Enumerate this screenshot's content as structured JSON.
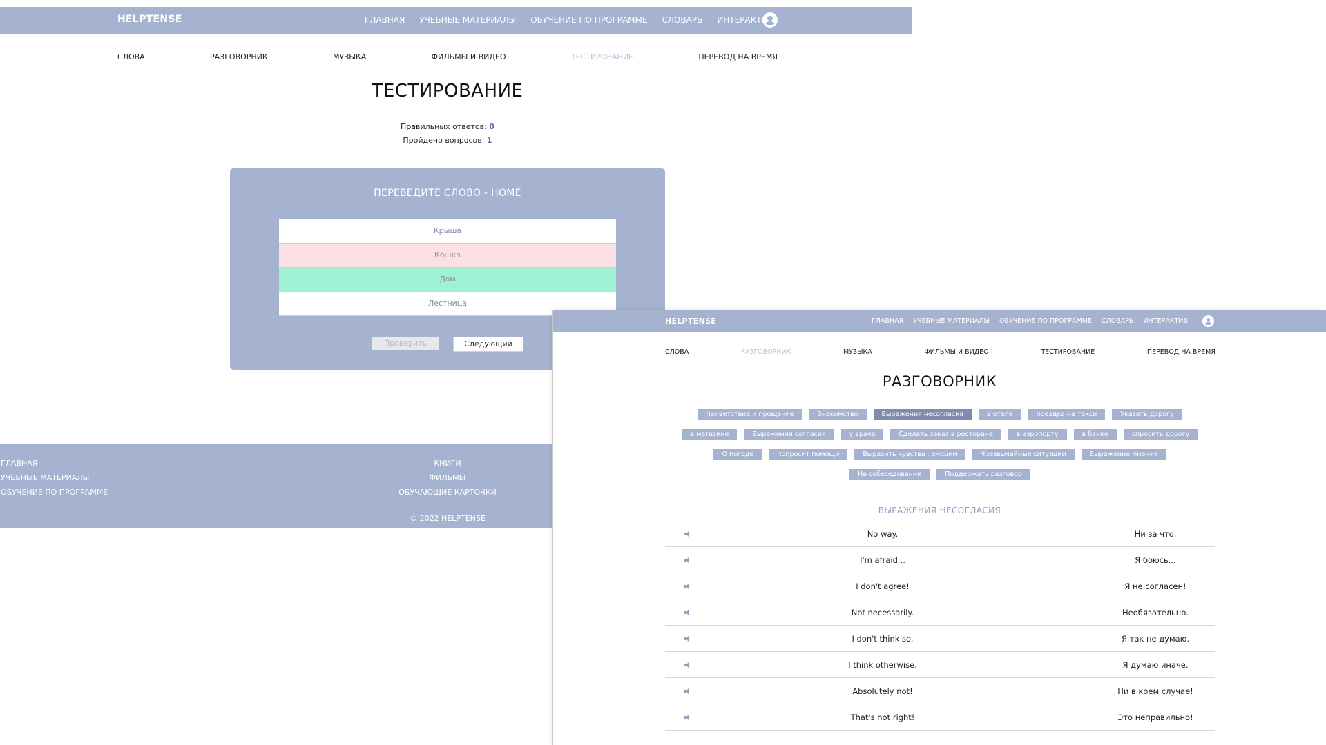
{
  "brand": "HELPTENSE",
  "topnav": [
    "ГЛАВНАЯ",
    "УЧЕБНЫЕ МАТЕРИАЛЫ",
    "ОБУЧЕНИЕ ПО ПРОГРАММЕ",
    "СЛОВАРЬ",
    "ИНТЕРАКТИВ"
  ],
  "subnav": [
    "СЛОВА",
    "РАЗГОВОРНИК",
    "МУЗЫКА",
    "ФИЛЬМЫ И ВИДЕО",
    "ТЕСТИРОВАНИЕ",
    "ПЕРЕВОД НА ВРЕМЯ"
  ],
  "testing_window": {
    "active_subnav": "ТЕСТИРОВАНИЕ",
    "title": "ТЕСТИРОВАНИЕ",
    "correct_label": "Правильных ответов:",
    "correct_value": "0",
    "passed_label": "Пройдено вопросов:",
    "passed_value": "1",
    "question": "ПЕРЕВЕДИТЕ СЛОВО - HOME",
    "options": [
      {
        "text": "Крыша",
        "state": "normal"
      },
      {
        "text": "Кошка",
        "state": "wrong"
      },
      {
        "text": "Дом",
        "state": "right"
      },
      {
        "text": "Лестница",
        "state": "normal"
      }
    ],
    "check_label": "Проверить",
    "next_label": "Следующий",
    "footer": {
      "left_links": [
        "ГЛАВНАЯ",
        "УЧЕБНЫЕ МАТЕРИАЛЫ",
        "ОБУЧЕНИЕ ПО ПРОГРАММЕ"
      ],
      "center_links": [
        "КНИГИ",
        "ФИЛЬМЫ",
        "ОБУЧАЮЩИЕ КАРТОЧКИ"
      ],
      "copyright": "© 2022 HELPTENSE"
    }
  },
  "phrasebook_window": {
    "active_subnav": "РАЗГОВОРНИК",
    "title": "РАЗГОВОРНИК",
    "tag_rows": [
      [
        "приветствие и прощание",
        "Знакомство",
        "Выражения несогласия",
        "в отеле",
        "поездка на такси",
        "Указать дорогу"
      ],
      [
        "в магазине",
        "Выражения согласия",
        "у врача",
        "Сделать заказ в ресторане",
        "в аэропорту",
        "в банке",
        "спросить дорогу"
      ],
      [
        "О погоде",
        "попросит помощи",
        "Выразить чувства , эмоции",
        "Чрезвычайные ситуации",
        "Выражение мнения"
      ],
      [
        "На собеседовании",
        "Поддержать разговор"
      ]
    ],
    "active_tag": "Выражения несогласия",
    "section_title": "ВЫРАЖЕНИЯ НЕСОГЛАСИЯ",
    "phrases": [
      {
        "en": "No way.",
        "ru": "Ни за что."
      },
      {
        "en": "I'm afraid...",
        "ru": "Я боюсь..."
      },
      {
        "en": "I don't agree!",
        "ru": "Я не согласен!"
      },
      {
        "en": "Not necessarily.",
        "ru": "Необязательно."
      },
      {
        "en": "I don't think so.",
        "ru": "Я так не думаю."
      },
      {
        "en": "I think otherwise.",
        "ru": "Я думаю иначе."
      },
      {
        "en": "Absolutely not!",
        "ru": "Ни в коем случае!"
      },
      {
        "en": "That's not right!",
        "ru": "Это неправильно!"
      }
    ]
  }
}
